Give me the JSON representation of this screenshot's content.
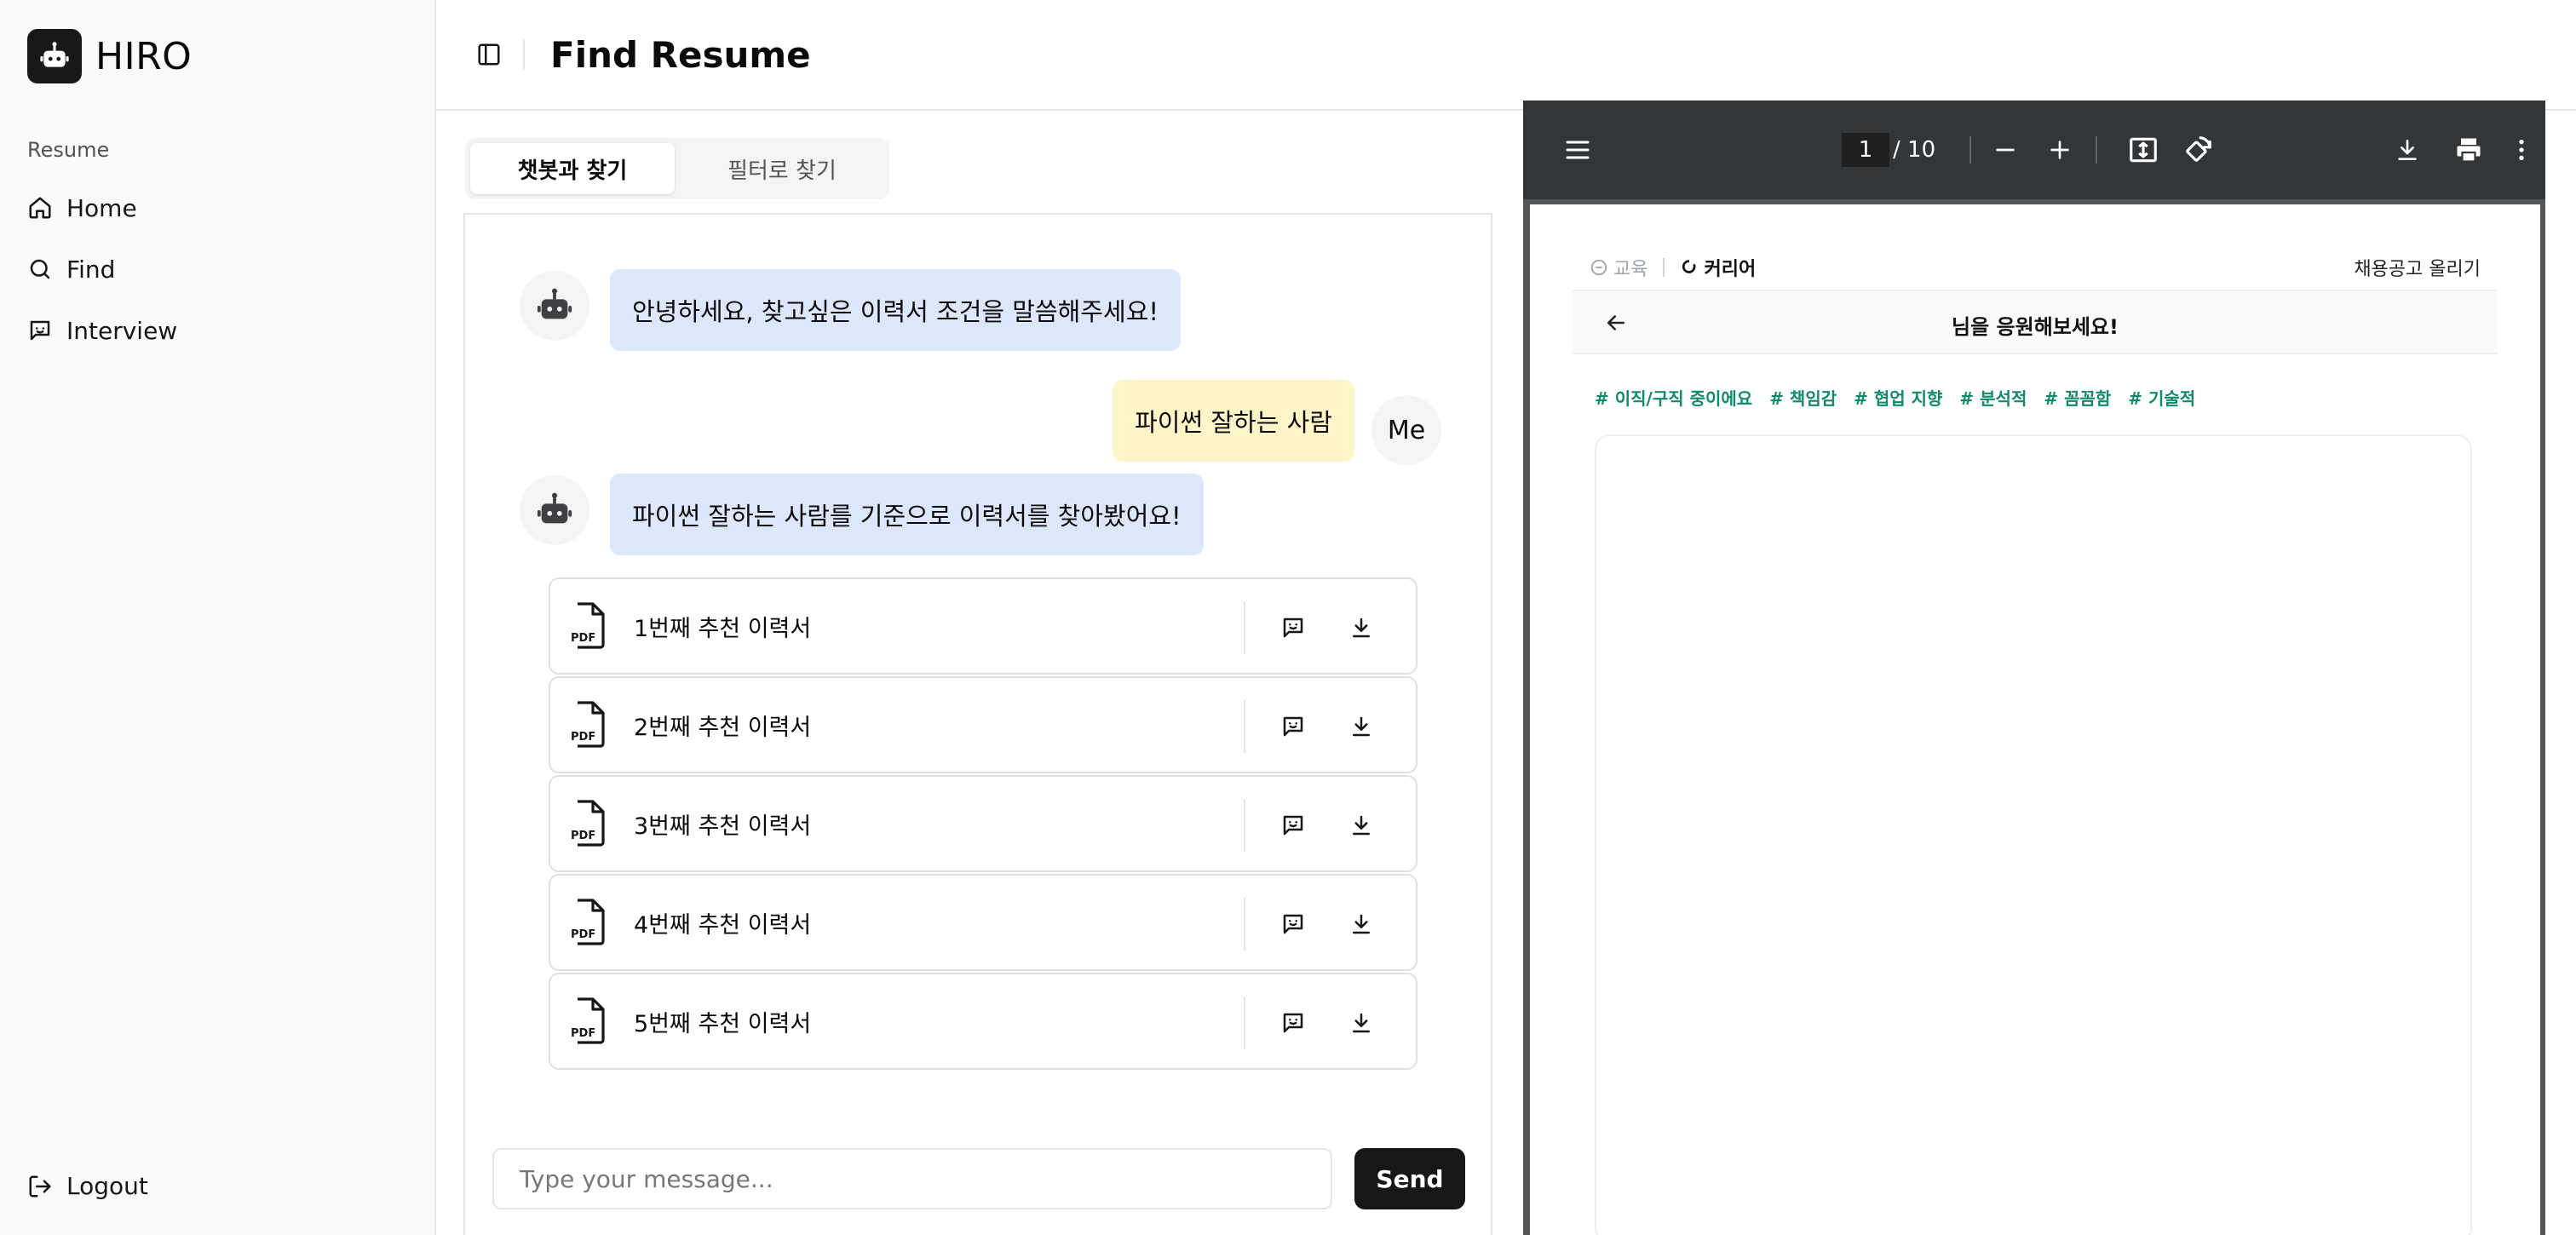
{
  "app": {
    "name": "HIRO"
  },
  "sidebar": {
    "group_label": "Resume",
    "items": [
      {
        "label": "Home",
        "icon": "home-icon"
      },
      {
        "label": "Find",
        "icon": "search-icon"
      },
      {
        "label": "Interview",
        "icon": "message-square-icon"
      }
    ],
    "logout_label": "Logout"
  },
  "header": {
    "title": "Find Resume"
  },
  "tabs": [
    {
      "label": "챗봇과 찾기",
      "active": true
    },
    {
      "label": "필터로 찾기",
      "active": false
    }
  ],
  "chat": {
    "messages": [
      {
        "from": "bot",
        "text": "안녕하세요, 찾고싶은 이력서 조건을 말씀해주세요!"
      },
      {
        "from": "me",
        "text": "파이썬 잘하는 사람",
        "avatar_label": "Me"
      },
      {
        "from": "bot",
        "text": "파이썬 잘하는 사람를 기준으로 이력서를 찾아봤어요!"
      }
    ],
    "results": [
      {
        "label": "1번째 추천 이력서",
        "file_type": "PDF"
      },
      {
        "label": "2번째 추천 이력서",
        "file_type": "PDF"
      },
      {
        "label": "3번째 추천 이력서",
        "file_type": "PDF"
      },
      {
        "label": "4번째 추천 이력서",
        "file_type": "PDF"
      },
      {
        "label": "5번째 추천 이력서",
        "file_type": "PDF"
      }
    ],
    "input": {
      "placeholder": "Type your message...",
      "value": ""
    },
    "send_label": "Send"
  },
  "viewer": {
    "current_page": "1",
    "total_pages": "/ 10",
    "page_content": {
      "nav_left": "교육",
      "nav_active": "커리어",
      "post_job": "채용공고 올리기",
      "cheer": "님을 응원해보세요!",
      "tags": [
        "# 이직/구직 중이에요",
        "# 책임감",
        "# 협업 지향",
        "# 분석적",
        "# 꼼꼼함",
        "# 기술적"
      ]
    }
  },
  "colors": {
    "bot_bubble": "#dce7fb",
    "me_bubble": "#fdf5c7",
    "send_button": "#171717",
    "viewer_toolbar": "#323639",
    "tag_green": "#0f8a6a"
  }
}
